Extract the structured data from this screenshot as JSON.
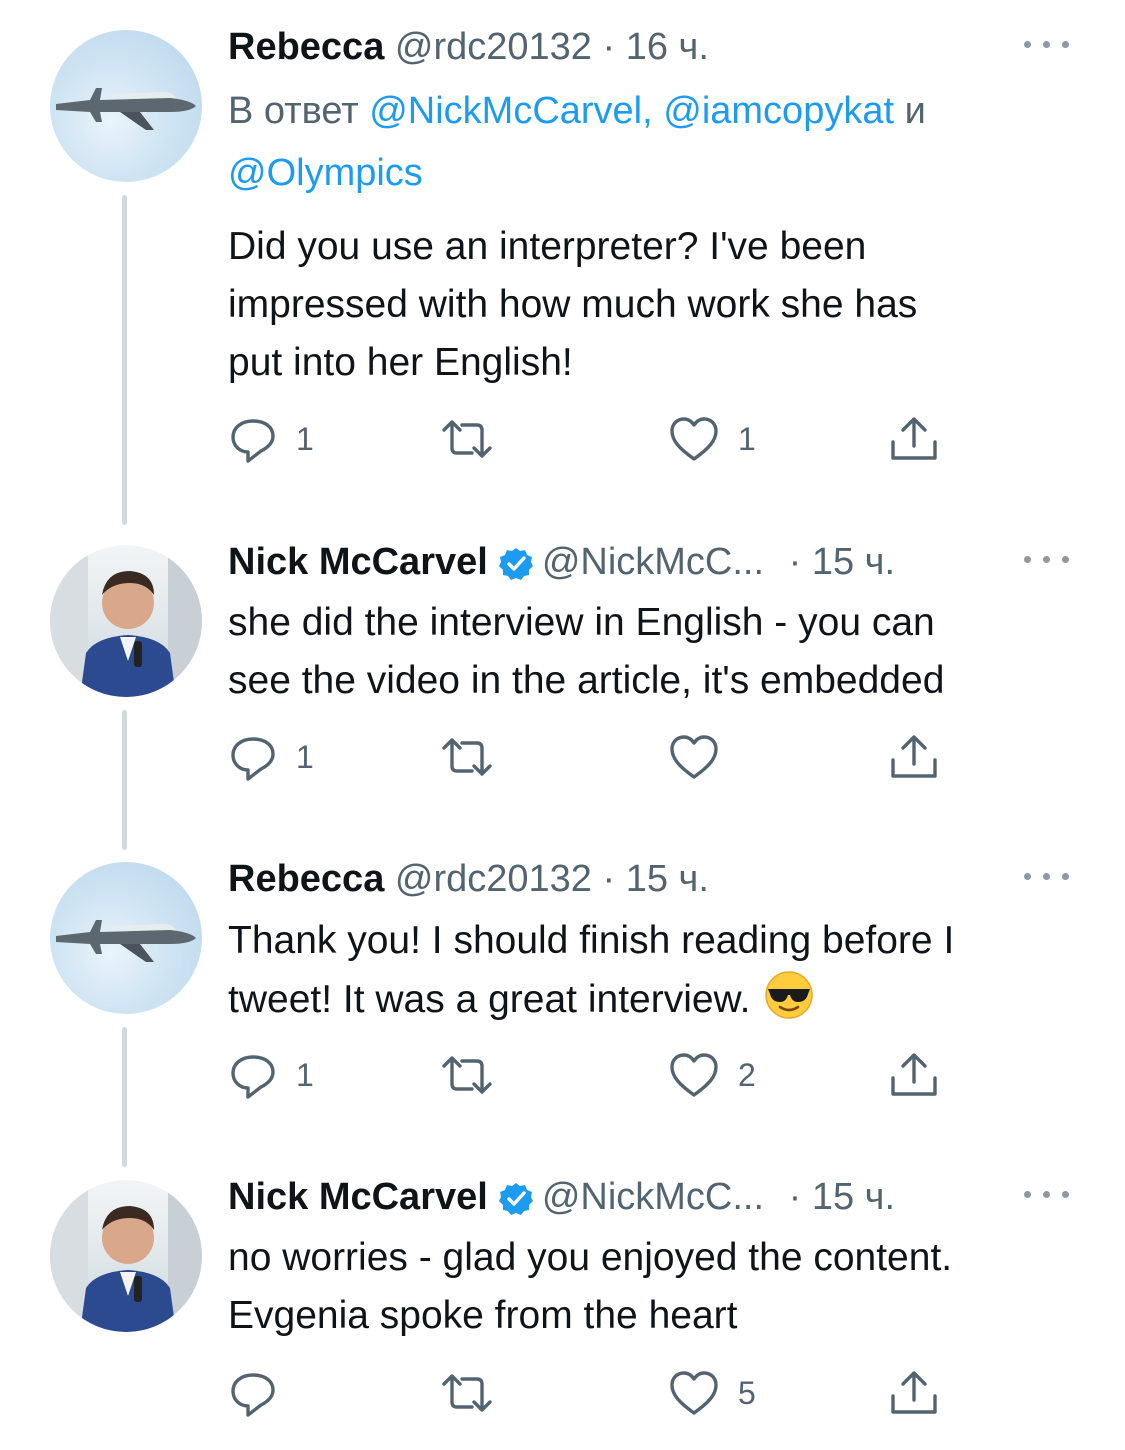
{
  "tweets": [
    {
      "name": "Rebecca",
      "handle": "@rdc20132",
      "time": "· 16 ч.",
      "avatar_icon": "airplane-avatar",
      "reply_prefix": "В ответ ",
      "reply_mention_1": "@NickMcCarvel,",
      "reply_mention_2": "@iamcopykat",
      "reply_conj": " и",
      "reply_mention_3": "@Olympics",
      "line1": "Did you use an interpreter? I've been",
      "line2": "impressed with how much work she has",
      "line3": "put into her English!",
      "reply_count": "1",
      "like_count": "1"
    },
    {
      "name": "Nick McCarvel",
      "handle": "@NickMcC...",
      "time": "· 15 ч.",
      "avatar_icon": "person-avatar",
      "line1": "she did the interview in English - you can",
      "line2": "see the video in the article, it's embedded",
      "reply_count": "1",
      "like_count": ""
    },
    {
      "name": "Rebecca",
      "handle": "@rdc20132",
      "time": "· 15 ч.",
      "avatar_icon": "airplane-avatar",
      "line1": "Thank you! I should finish reading before I",
      "line2": "tweet! It was a great interview.",
      "emoji": "smiling-face-with-sunglasses",
      "reply_count": "1",
      "like_count": "2"
    },
    {
      "name": "Nick McCarvel",
      "handle": "@NickMcC...",
      "time": "· 15 ч.",
      "avatar_icon": "person-avatar",
      "line1": "no worries - glad you enjoyed the content.",
      "line2": "Evgenia spoke from the heart",
      "reply_count": "",
      "like_count": "5"
    }
  ],
  "colors": {
    "link": "#1d9bf0",
    "secondary": "#536471",
    "thread_line": "#cfd9de",
    "verified": "#1d9bf0"
  }
}
